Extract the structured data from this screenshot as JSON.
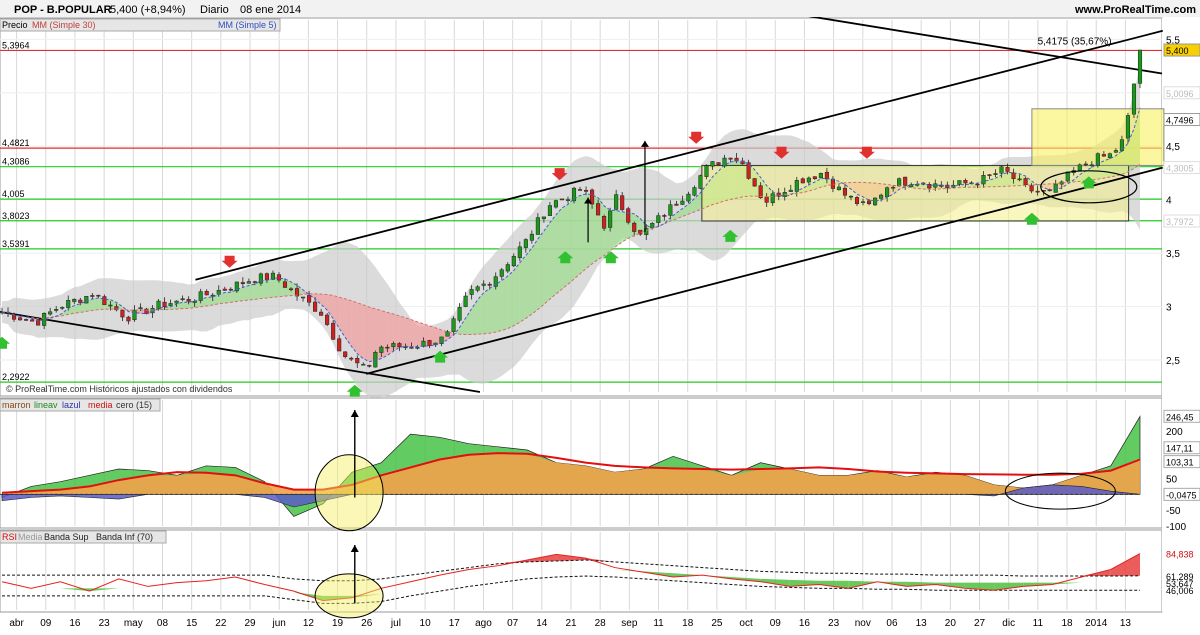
{
  "header": {
    "ticker": "POP - B.POPULAR",
    "quote": "5,400 (+8,94%)",
    "frequency": "Diario",
    "date": "08 ene 2014",
    "source": "www.ProRealTime.com",
    "footnote": "© ProRealTime.com Históricos ajustados con dividendos"
  },
  "legends": {
    "price": [
      "Precio",
      "MM (Simple 30)",
      "MM (Simple 5)"
    ],
    "osc": [
      "marron",
      "lineav",
      "lazul",
      "media",
      "cero (15)"
    ],
    "rsi": [
      "RSI",
      "Media",
      "Banda Sup",
      "Banda Inf (70)"
    ]
  },
  "colors": {
    "candle_up": "#1a9a1a",
    "candle_down": "#d02020",
    "support": "#22cc22",
    "resistance": "#e03030",
    "osc_green": "#3bbf3b",
    "osc_orange": "#f2a24a",
    "osc_blue": "#5a5ac8",
    "media_line": "#e01010",
    "rsi_line": "#e82020"
  },
  "chart_data": [
    {
      "type": "candlestick",
      "panel": "price",
      "ylim": [
        2.2,
        5.55
      ],
      "y_ticks": [
        "5,5",
        "5",
        "4,5",
        "4",
        "3,5",
        "3",
        "2,5"
      ],
      "x_ticks": [
        "abr",
        "09",
        "16",
        "23",
        "may",
        "08",
        "15",
        "22",
        "29",
        "jun",
        "12",
        "19",
        "26",
        "jul",
        "10",
        "17",
        "ago",
        "07",
        "14",
        "21",
        "28",
        "sep",
        "11",
        "18",
        "25",
        "oct",
        "09",
        "16",
        "23",
        "nov",
        "06",
        "13",
        "20",
        "27",
        "dic",
        "11",
        "18",
        "2014",
        "13"
      ],
      "key_points": [
        {
          "t": 0.0,
          "v": 2.95
        },
        {
          "t": 0.03,
          "v": 2.85
        },
        {
          "t": 0.05,
          "v": 3.0
        },
        {
          "t": 0.08,
          "v": 3.12
        },
        {
          "t": 0.11,
          "v": 2.9
        },
        {
          "t": 0.14,
          "v": 3.02
        },
        {
          "t": 0.17,
          "v": 3.08
        },
        {
          "t": 0.2,
          "v": 3.18
        },
        {
          "t": 0.22,
          "v": 3.26
        },
        {
          "t": 0.24,
          "v": 3.28
        },
        {
          "t": 0.26,
          "v": 3.1
        },
        {
          "t": 0.28,
          "v": 2.95
        },
        {
          "t": 0.3,
          "v": 2.55
        },
        {
          "t": 0.32,
          "v": 2.4
        },
        {
          "t": 0.33,
          "v": 2.62
        },
        {
          "t": 0.36,
          "v": 2.63
        },
        {
          "t": 0.39,
          "v": 2.7
        },
        {
          "t": 0.41,
          "v": 3.12
        },
        {
          "t": 0.43,
          "v": 3.25
        },
        {
          "t": 0.46,
          "v": 3.6
        },
        {
          "t": 0.48,
          "v": 3.95
        },
        {
          "t": 0.5,
          "v": 4.05
        },
        {
          "t": 0.51,
          "v": 4.1
        },
        {
          "t": 0.53,
          "v": 3.75
        },
        {
          "t": 0.54,
          "v": 4.02
        },
        {
          "t": 0.56,
          "v": 3.65
        },
        {
          "t": 0.58,
          "v": 3.85
        },
        {
          "t": 0.6,
          "v": 4.05
        },
        {
          "t": 0.62,
          "v": 4.3
        },
        {
          "t": 0.64,
          "v": 4.42
        },
        {
          "t": 0.65,
          "v": 4.35
        },
        {
          "t": 0.67,
          "v": 3.98
        },
        {
          "t": 0.7,
          "v": 4.18
        },
        {
          "t": 0.72,
          "v": 4.25
        },
        {
          "t": 0.74,
          "v": 4.05
        },
        {
          "t": 0.76,
          "v": 3.92
        },
        {
          "t": 0.78,
          "v": 4.15
        },
        {
          "t": 0.8,
          "v": 4.18
        },
        {
          "t": 0.83,
          "v": 4.12
        },
        {
          "t": 0.86,
          "v": 4.18
        },
        {
          "t": 0.88,
          "v": 4.28
        },
        {
          "t": 0.9,
          "v": 4.1
        },
        {
          "t": 0.92,
          "v": 4.05
        },
        {
          "t": 0.94,
          "v": 4.25
        },
        {
          "t": 0.96,
          "v": 4.38
        },
        {
          "t": 0.975,
          "v": 4.42
        },
        {
          "t": 0.985,
          "v": 4.55
        },
        {
          "t": 0.993,
          "v": 4.98
        },
        {
          "t": 1.0,
          "v": 5.4
        }
      ],
      "moving_averages": {
        "sma30": "MM (Simple 30)",
        "sma5": "MM (Simple 5)"
      },
      "horizontal_levels": [
        {
          "value": 5.3964,
          "label": "5,3964",
          "kind": "resistance"
        },
        {
          "value": 4.4821,
          "label": "4,4821",
          "kind": "resistance"
        },
        {
          "value": 4.3086,
          "label": "4,3086",
          "kind": "support"
        },
        {
          "value": 4.005,
          "label": "4,005",
          "kind": "support"
        },
        {
          "value": 3.8023,
          "label": "3,8023",
          "kind": "support"
        },
        {
          "value": 3.5391,
          "label": "3,5391",
          "kind": "support"
        },
        {
          "value": 2.2922,
          "label": "2,2922",
          "kind": "support"
        }
      ],
      "right_axis_labels": [
        {
          "value": 5.4,
          "label": "5,400",
          "style": "last"
        },
        {
          "value": 4.7496,
          "label": "4,7496",
          "style": "box"
        },
        {
          "value": 5.0,
          "label": "5,0096",
          "style": "faded"
        },
        {
          "value": 4.3,
          "label": "4,3005",
          "style": "faded"
        },
        {
          "value": 3.8,
          "label": "3,7972",
          "style": "faded"
        }
      ],
      "annotation": {
        "text": "5,4175 (35,67%)",
        "t": 0.91,
        "value": 5.45
      }
    },
    {
      "type": "area",
      "panel": "oscillator",
      "ylim": [
        -100,
        260
      ],
      "y_ticks": [
        "200",
        "100",
        "50",
        "0",
        "-50",
        "-100"
      ],
      "right_labels": [
        "246,45",
        "147,11",
        "103,31",
        "-0,0475"
      ],
      "series": [
        {
          "name": "media",
          "values": [
            5,
            10,
            15,
            25,
            45,
            60,
            70,
            68,
            60,
            35,
            15,
            15,
            30,
            60,
            85,
            110,
            125,
            130,
            128,
            115,
            100,
            90,
            85,
            82,
            80,
            78,
            80,
            82,
            85,
            80,
            72,
            68,
            66,
            64,
            63,
            62,
            62,
            65,
            75,
            110
          ]
        },
        {
          "name": "lineav",
          "values": [
            -10,
            25,
            40,
            60,
            80,
            75,
            60,
            90,
            85,
            40,
            -70,
            -30,
            70,
            100,
            190,
            180,
            160,
            150,
            140,
            100,
            90,
            70,
            80,
            120,
            90,
            60,
            100,
            80,
            60,
            60,
            75,
            55,
            70,
            60,
            30,
            20,
            30,
            60,
            90,
            246
          ]
        },
        {
          "name": "lazul",
          "values": [
            -20,
            -10,
            -5,
            -10,
            -15,
            0,
            0,
            0,
            0,
            -10,
            -40,
            -20,
            0,
            0,
            0,
            0,
            0,
            0,
            0,
            0,
            0,
            0,
            0,
            0,
            0,
            0,
            0,
            0,
            0,
            0,
            0,
            0,
            0,
            0,
            -5,
            20,
            30,
            25,
            10,
            0
          ]
        }
      ]
    },
    {
      "type": "line",
      "panel": "rsi",
      "ylim": [
        25,
        95
      ],
      "right_labels": [
        "84,838",
        "61,289",
        "53,647",
        "46,006"
      ],
      "series": [
        {
          "name": "RSI",
          "values": [
            55,
            48,
            55,
            45,
            58,
            50,
            54,
            56,
            60,
            52,
            45,
            35,
            38,
            48,
            55,
            62,
            68,
            72,
            78,
            84,
            80,
            70,
            65,
            60,
            62,
            58,
            55,
            50,
            52,
            48,
            55,
            50,
            52,
            48,
            46,
            50,
            52,
            60,
            68,
            84.8
          ]
        },
        {
          "name": "Banda Sup",
          "values": [
            62,
            62,
            62,
            62,
            62,
            62,
            62,
            62,
            62,
            62,
            58,
            56,
            56,
            58,
            62,
            66,
            70,
            74,
            76,
            77,
            78,
            76,
            74,
            72,
            70,
            68,
            66,
            65,
            64,
            64,
            63,
            63,
            62,
            62,
            62,
            61,
            61,
            61,
            61,
            61.3
          ]
        },
        {
          "name": "Banda Inf (70)",
          "values": [
            40,
            40,
            40,
            40,
            40,
            40,
            40,
            40,
            40,
            40,
            36,
            32,
            32,
            34,
            40,
            45,
            50,
            54,
            58,
            60,
            61,
            60,
            58,
            56,
            54,
            52,
            50,
            49,
            48,
            48,
            47,
            47,
            46,
            46,
            46,
            46,
            46,
            46,
            46,
            46.0
          ]
        }
      ]
    }
  ]
}
